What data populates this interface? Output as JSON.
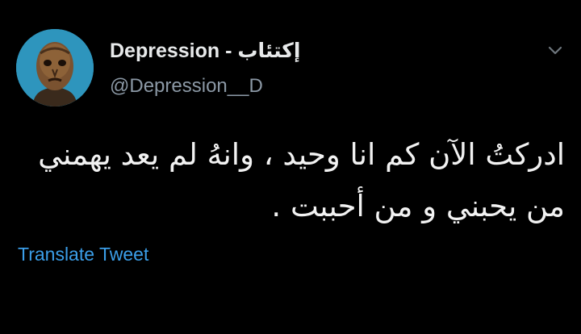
{
  "author": {
    "display_name": "Depression - إكتئاب",
    "handle": "@Depression__D"
  },
  "icons": {
    "avatar": "avatar-image",
    "menu": "chevron-down-icon"
  },
  "tweet": {
    "lines": [
      "ادركتُ الآن كم انا وحيد ، وانهُ لم يعد يهمني",
      "من يحبني و من أحببت ."
    ]
  },
  "actions": {
    "translate_label": "Translate Tweet"
  },
  "colors": {
    "background": "#000000",
    "name_text": "#e7e9ea",
    "handle_text": "#8b98a5",
    "link": "#3b9ee8",
    "avatar_bg": "#2e95bd"
  }
}
